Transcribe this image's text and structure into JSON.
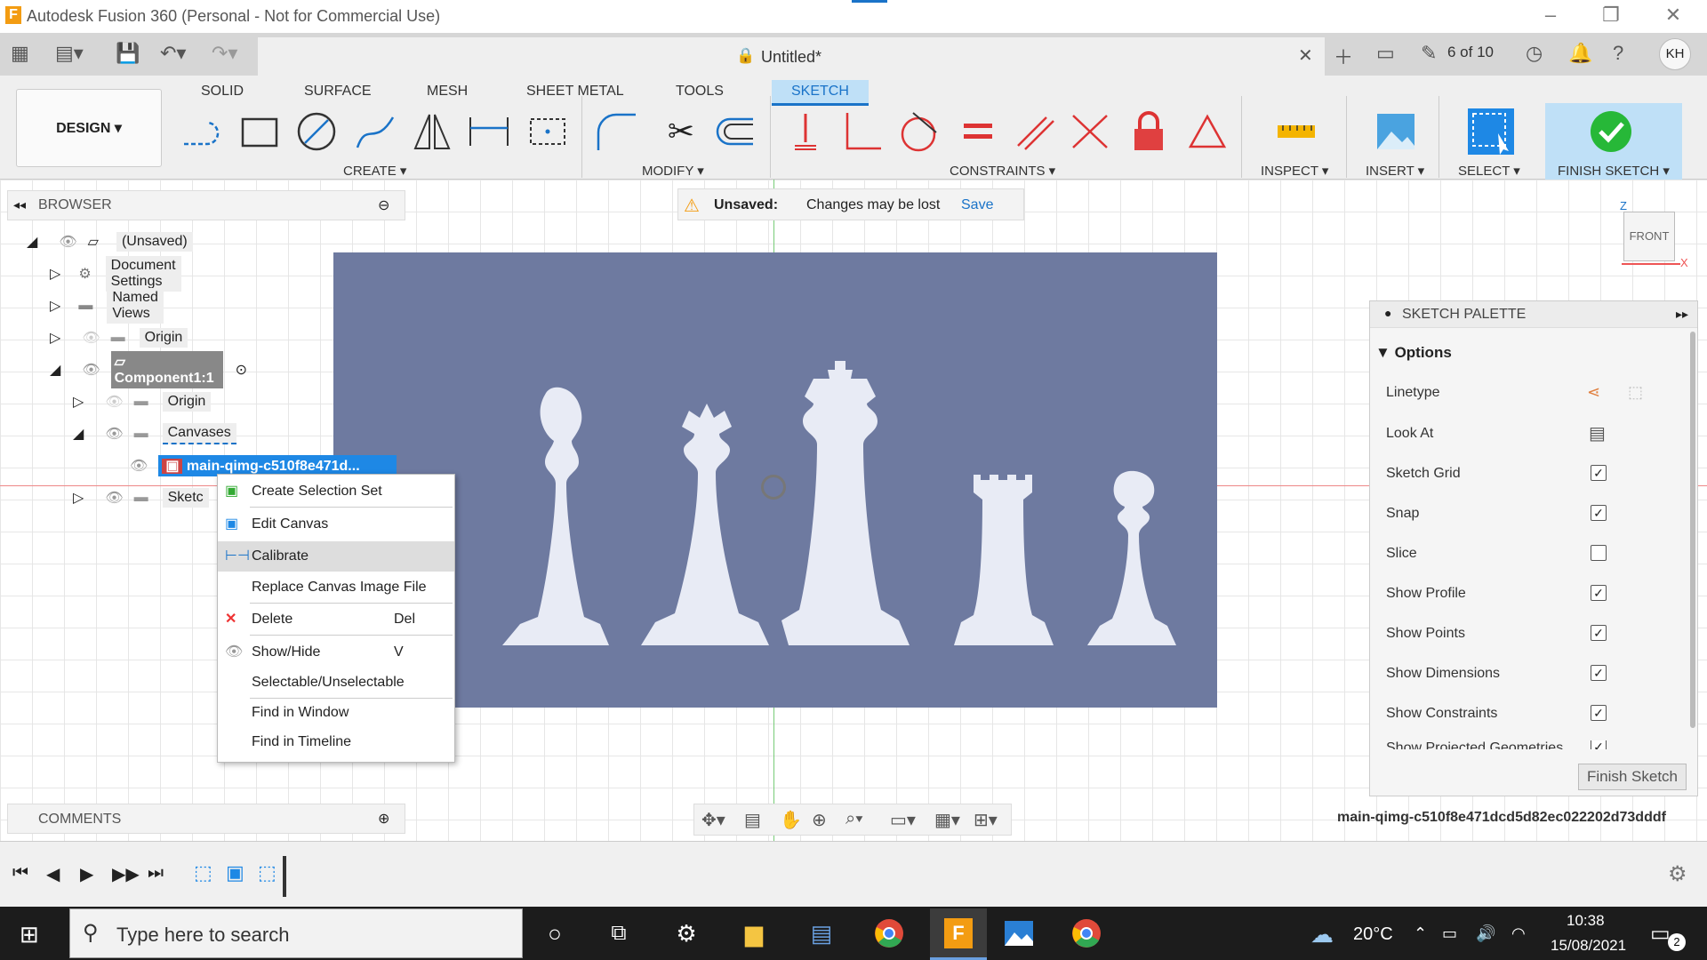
{
  "window": {
    "title": "Autodesk Fusion 360 (Personal - Not for Commercial Use)"
  },
  "appbar": {
    "doc_title": "Untitled*",
    "version": "6 of 10",
    "user": "KH"
  },
  "ribbon": {
    "tabs": [
      "SOLID",
      "SURFACE",
      "MESH",
      "SHEET METAL",
      "TOOLS",
      "SKETCH"
    ],
    "active_tab": "SKETCH",
    "workspace": "DESIGN",
    "groups": {
      "create": "CREATE",
      "modify": "MODIFY",
      "constraints": "CONSTRAINTS",
      "inspect": "INSPECT",
      "insert": "INSERT",
      "select": "SELECT",
      "finish": "FINISH SKETCH"
    }
  },
  "unsaved": {
    "label": "Unsaved:",
    "message": "Changes may be lost",
    "save": "Save"
  },
  "browser": {
    "title": "BROWSER",
    "items": [
      {
        "label": "(Unsaved)"
      },
      {
        "label": "Document Settings"
      },
      {
        "label": "Named Views"
      },
      {
        "label": "Origin"
      },
      {
        "label": "Component1:1"
      },
      {
        "label": "Origin"
      },
      {
        "label": "Canvases"
      },
      {
        "label": "main-qimg-c510f8e471d..."
      },
      {
        "label": "Sketc"
      }
    ]
  },
  "context_menu": {
    "items": [
      {
        "label": "Create Selection Set",
        "key": ""
      },
      {
        "label": "Edit Canvas",
        "key": ""
      },
      {
        "label": "Calibrate",
        "key": ""
      },
      {
        "label": "Replace Canvas Image File",
        "key": ""
      },
      {
        "label": "Delete",
        "key": "Del"
      },
      {
        "label": "Show/Hide",
        "key": "V"
      },
      {
        "label": "Selectable/Unselectable",
        "key": ""
      },
      {
        "label": "Find in Window",
        "key": ""
      },
      {
        "label": "Find in Timeline",
        "key": ""
      }
    ]
  },
  "viewcube": {
    "face": "FRONT",
    "z": "Z",
    "x": "X"
  },
  "palette": {
    "title": "SKETCH PALETTE",
    "section": "Options",
    "rows": [
      {
        "label": "Linetype"
      },
      {
        "label": "Look At"
      },
      {
        "label": "Sketch Grid",
        "checked": true
      },
      {
        "label": "Snap",
        "checked": true
      },
      {
        "label": "Slice",
        "checked": false
      },
      {
        "label": "Show Profile",
        "checked": true
      },
      {
        "label": "Show Points",
        "checked": true
      },
      {
        "label": "Show Dimensions",
        "checked": true
      },
      {
        "label": "Show Constraints",
        "checked": true
      },
      {
        "label": "Show Projected Geometries",
        "checked": true
      }
    ],
    "finish_button": "Finish Sketch"
  },
  "comments": {
    "title": "COMMENTS"
  },
  "status": {
    "canvas_name": "main-qimg-c510f8e471dcd5d82ec022202d73dddf"
  },
  "taskbar": {
    "search_placeholder": "Type here to search",
    "temperature": "20°C",
    "time": "10:38",
    "date": "15/08/2021",
    "notifications": "2"
  },
  "colors": {
    "accent": "#1a73c8",
    "selected": "#1e88e5",
    "canvas": "#6e7aa0",
    "taskbar": "#1c1c1c"
  }
}
